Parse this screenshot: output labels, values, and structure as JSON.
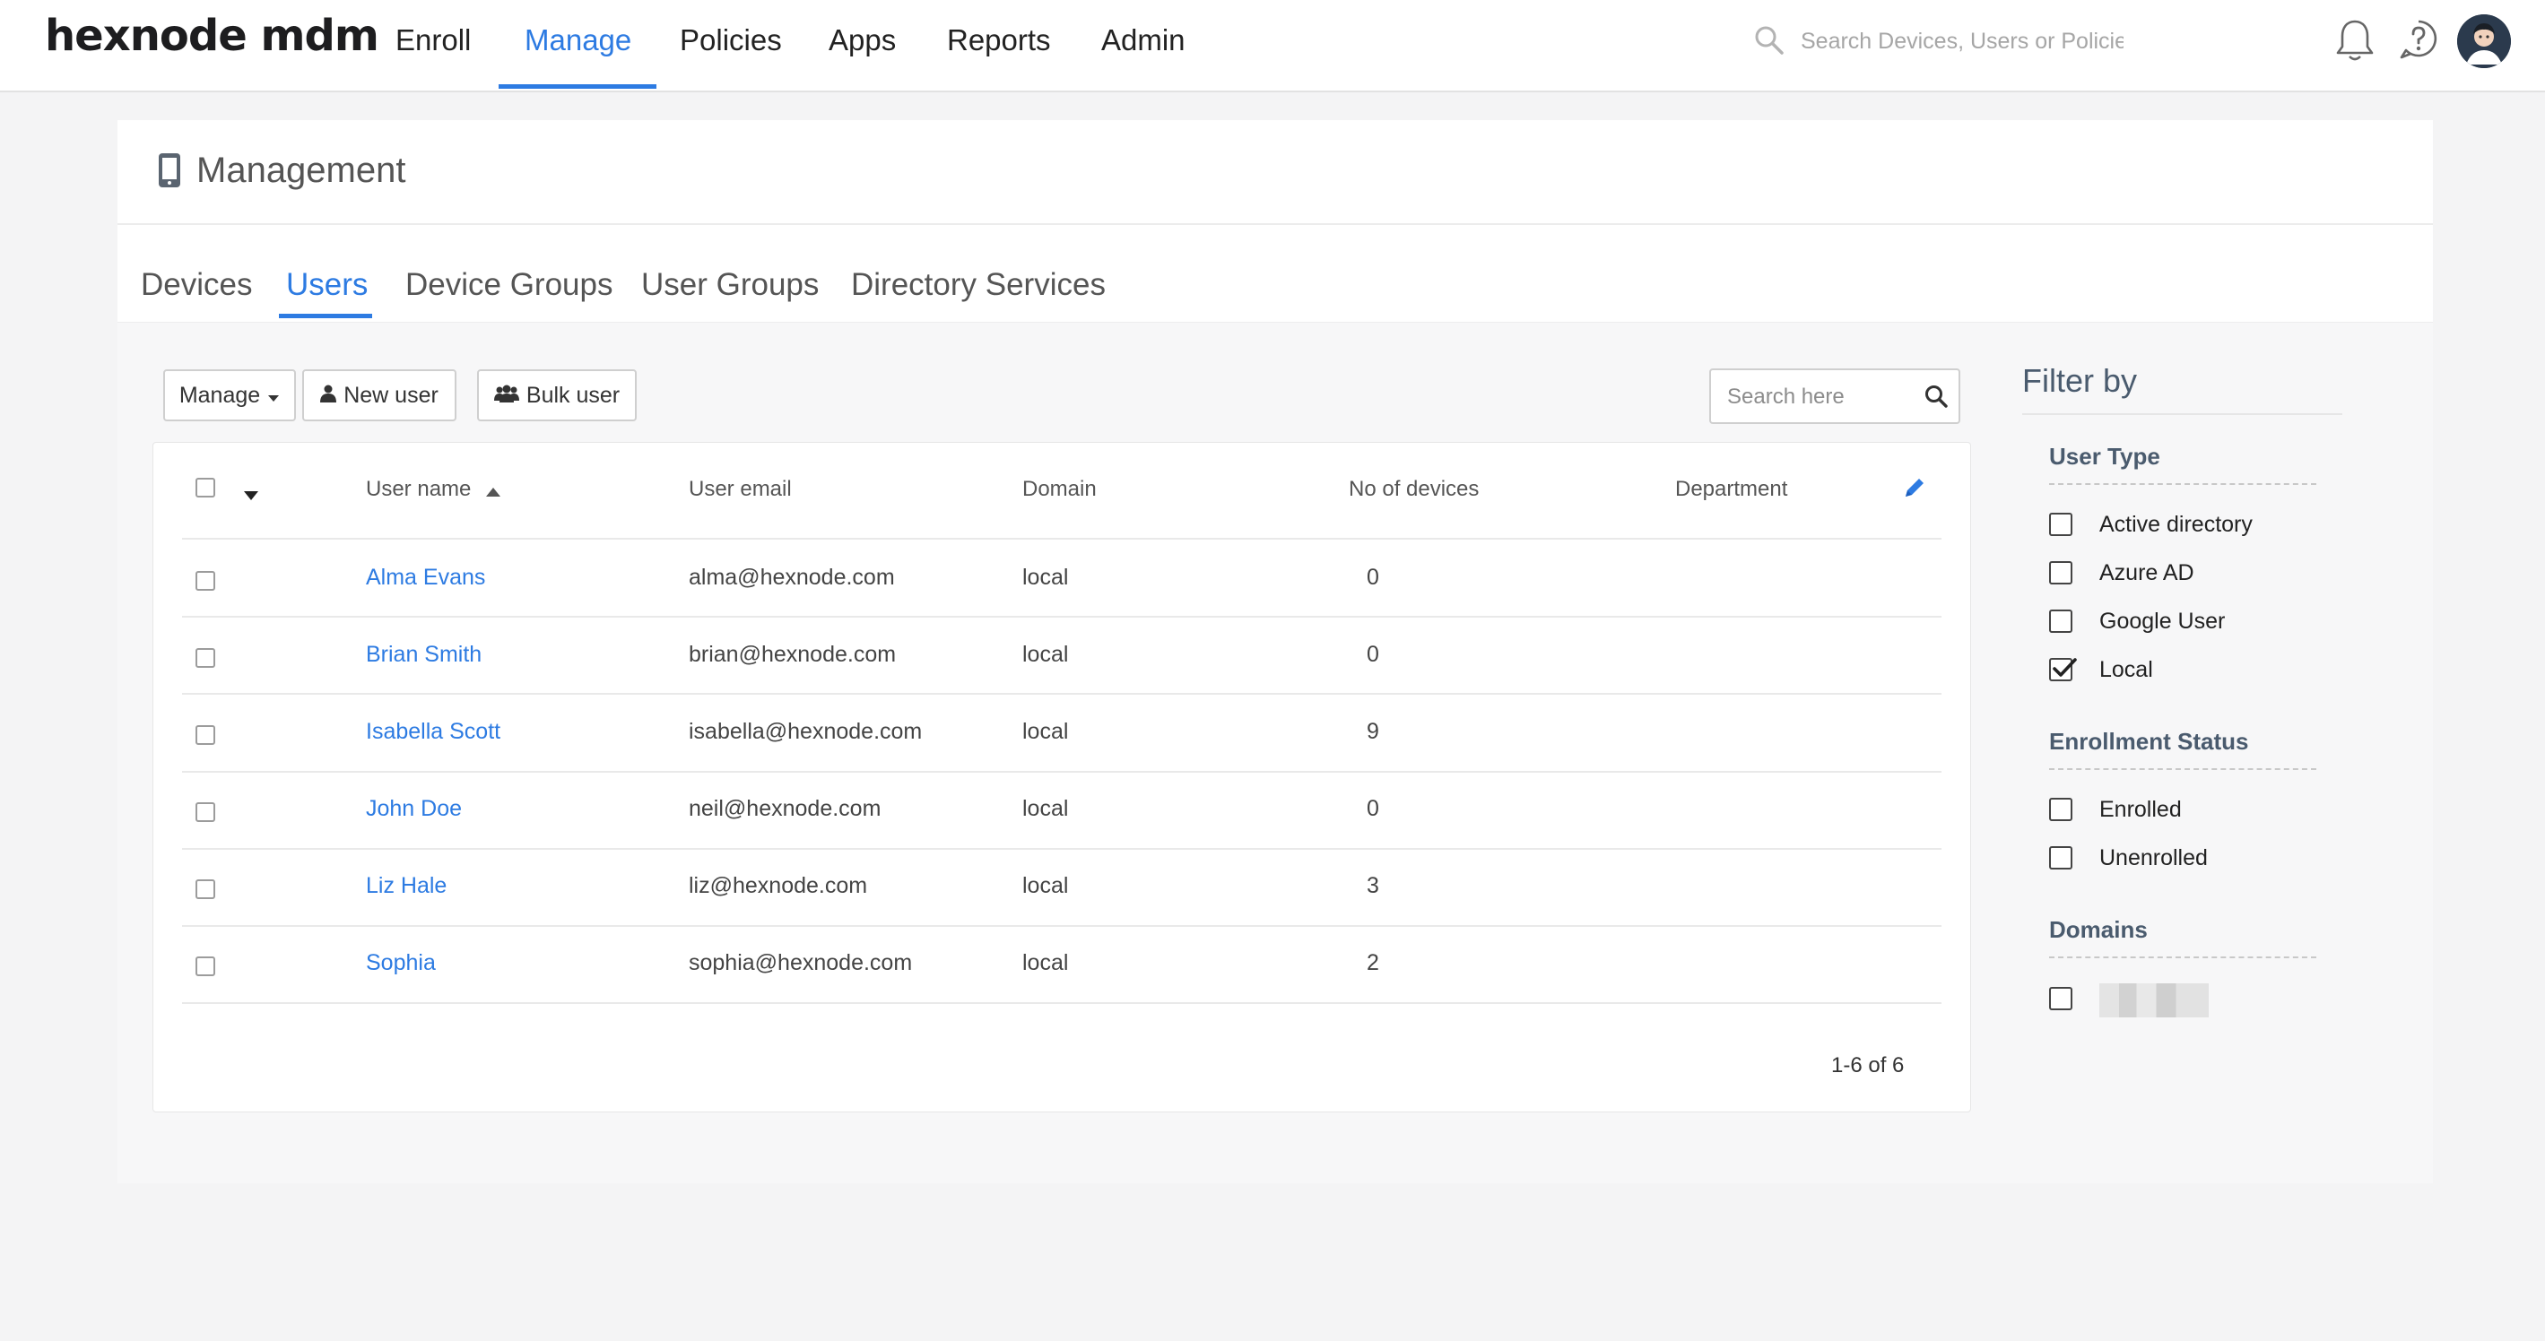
{
  "app": {
    "logo": "hexnode mdm",
    "nav": [
      "Enroll",
      "Manage",
      "Policies",
      "Apps",
      "Reports",
      "Admin"
    ],
    "active_nav": "Manage",
    "search_placeholder": "Search Devices, Users or Policies",
    "accent_color": "#2d7be2"
  },
  "page": {
    "title": "Management",
    "title_icon": "mobile-phone-icon",
    "tabs": [
      "Devices",
      "Users",
      "Device Groups",
      "User Groups",
      "Directory Services"
    ],
    "active_tab": "Users"
  },
  "toolbar": {
    "manage_label": "Manage",
    "new_user_label": "New user",
    "bulk_user_label": "Bulk user",
    "search_placeholder": "Search here"
  },
  "table": {
    "columns": [
      "User name",
      "User email",
      "Domain",
      "No of devices",
      "Department"
    ],
    "sort_column": "User name",
    "sort_direction": "ascending",
    "rows": [
      {
        "name": "Alma Evans",
        "email": "alma@hexnode.com",
        "domain": "local",
        "devices": "0",
        "department": ""
      },
      {
        "name": "Brian Smith",
        "email": "brian@hexnode.com",
        "domain": "local",
        "devices": "0",
        "department": ""
      },
      {
        "name": "Isabella Scott",
        "email": "isabella@hexnode.com",
        "domain": "local",
        "devices": "9",
        "department": ""
      },
      {
        "name": "John Doe",
        "email": "neil@hexnode.com",
        "domain": "local",
        "devices": "0",
        "department": ""
      },
      {
        "name": "Liz Hale",
        "email": "liz@hexnode.com",
        "domain": "local",
        "devices": "3",
        "department": ""
      },
      {
        "name": "Sophia",
        "email": "sophia@hexnode.com",
        "domain": "local",
        "devices": "2",
        "department": ""
      }
    ],
    "pagination": "1-6 of 6"
  },
  "filter": {
    "title": "Filter by",
    "sections": [
      {
        "title": "User Type",
        "options": [
          {
            "label": "Active directory",
            "checked": false
          },
          {
            "label": "Azure AD",
            "checked": false
          },
          {
            "label": "Google User",
            "checked": false
          },
          {
            "label": "Local",
            "checked": true
          }
        ]
      },
      {
        "title": "Enrollment Status",
        "options": [
          {
            "label": "Enrolled",
            "checked": false
          },
          {
            "label": "Unenrolled",
            "checked": false
          }
        ]
      },
      {
        "title": "Domains",
        "options": [
          {
            "label": "",
            "checked": false,
            "obscured": true
          }
        ]
      }
    ]
  }
}
